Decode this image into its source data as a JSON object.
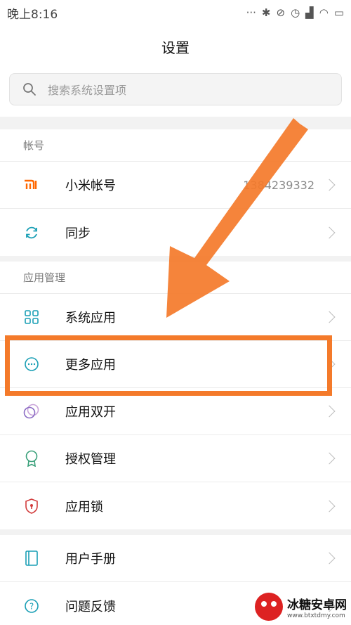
{
  "status_bar": {
    "time": "晚上8:16"
  },
  "header": {
    "title": "设置"
  },
  "search": {
    "placeholder": "搜索系统设置项"
  },
  "sections": {
    "account": {
      "title": "帐号",
      "items": [
        {
          "label": "小米帐号",
          "value": "1384239332",
          "icon": "mi-logo-icon"
        },
        {
          "label": "同步",
          "icon": "sync-icon"
        }
      ]
    },
    "apps": {
      "title": "应用管理",
      "items": [
        {
          "label": "系统应用",
          "icon": "grid-icon"
        },
        {
          "label": "更多应用",
          "icon": "more-icon"
        },
        {
          "label": "应用双开",
          "icon": "dual-app-icon"
        },
        {
          "label": "授权管理",
          "icon": "badge-icon"
        },
        {
          "label": "应用锁",
          "icon": "shield-lock-icon"
        }
      ]
    },
    "help": {
      "items": [
        {
          "label": "用户手册",
          "icon": "book-icon"
        },
        {
          "label": "问题反馈",
          "icon": "question-icon"
        }
      ]
    }
  },
  "colors": {
    "accent": "#f47a2a",
    "icon_teal": "#1a9fb5",
    "mi_orange": "#ff6700"
  },
  "watermark": {
    "name": "冰糖安卓网",
    "url": "www.btxtdmy.com"
  }
}
